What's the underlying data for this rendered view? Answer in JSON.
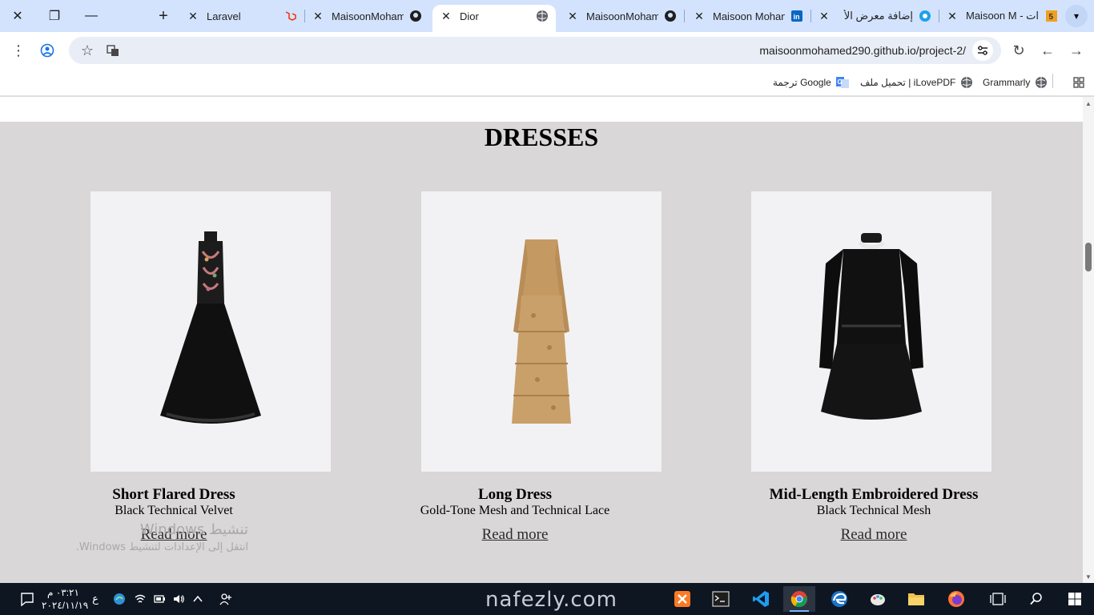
{
  "browser": {
    "tabs": [
      {
        "title": "Laravel",
        "icon": "laravel-icon",
        "active": false
      },
      {
        "title": "MaisoonMoham",
        "icon": "github-icon",
        "active": false
      },
      {
        "title": "Dior",
        "icon": "globe-icon",
        "active": true
      },
      {
        "title": "MaisoonMoham",
        "icon": "github-icon",
        "active": false
      },
      {
        "title": "Maisoon Mohan",
        "icon": "linkedin-icon",
        "active": false
      },
      {
        "title": "إضافة معرض الأ",
        "icon": "circle-app-icon",
        "active": false
      },
      {
        "title": "Maisoon M - ات",
        "icon": "html5-icon",
        "active": false
      }
    ],
    "url": "maisoonmohamed290.github.io/project-2/",
    "bookmarks": [
      {
        "label": "Grammarly",
        "icon": "globe-icon"
      },
      {
        "label": "تحميل ملف | iLovePDF",
        "icon": "globe-icon"
      },
      {
        "label": "ترجمة Google",
        "icon": "google-translate-icon"
      }
    ]
  },
  "page": {
    "section_title": "DRESSES",
    "products": [
      {
        "name": "Mid-Length Embroidered Dress",
        "description": "Black Technical Mesh",
        "link": "Read more"
      },
      {
        "name": "Long Dress",
        "description": "Gold-Tone Mesh and Technical Lace",
        "link": "Read more"
      },
      {
        "name": "Short Flared Dress",
        "description": "Black Technical Velvet",
        "link": "Read more"
      }
    ],
    "watermark": {
      "line1": "تنشيط Windows",
      "line2": "انتقل إلى الإعدادات لتنشيط Windows."
    }
  },
  "taskbar": {
    "time": "٠٣:٢١ م",
    "date": "٢٠٢٤/١١/١٩",
    "language": "ع",
    "brand": "nafezly.com"
  },
  "colors": {
    "tabstrip": "#d3e3fd",
    "page_background": "#d9d7d7",
    "card_background": "#f2f2f4",
    "taskbar": "#0e1622"
  }
}
